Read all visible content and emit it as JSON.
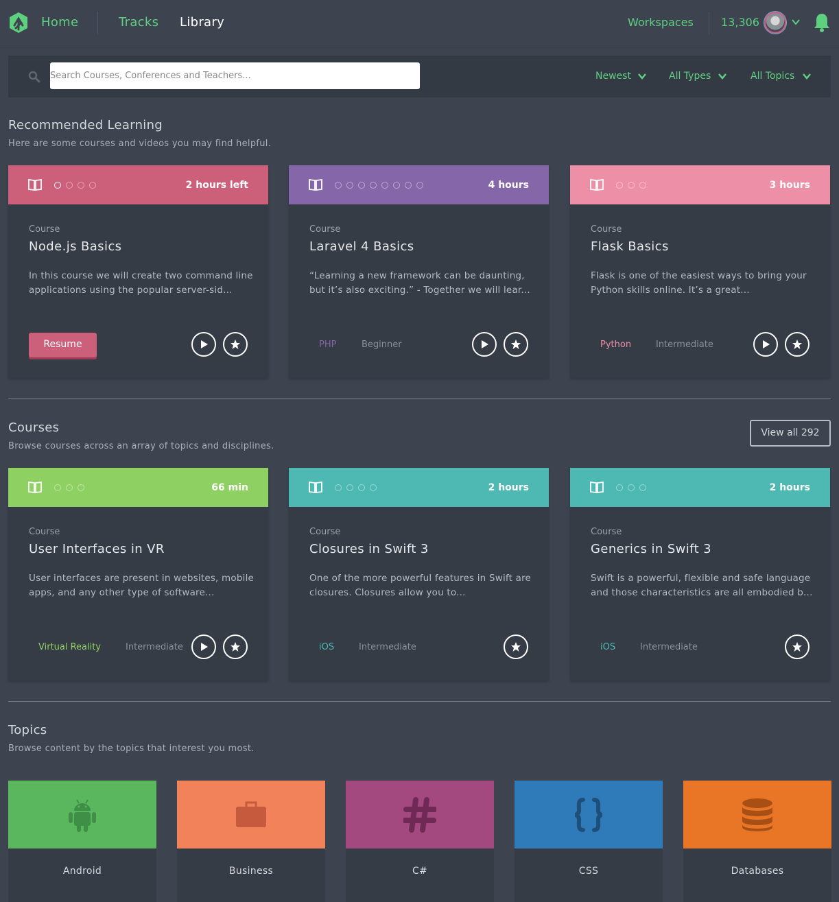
{
  "nav": {
    "home": "Home",
    "tracks": "Tracks",
    "library": "Library",
    "workspaces": "Workspaces",
    "points": "13,306"
  },
  "search": {
    "placeholder": "Search Courses, Conferences and Teachers...",
    "filters": [
      "Newest",
      "All Types",
      "All Topics"
    ]
  },
  "colors": {
    "accent": "#5fcf80",
    "nodejs": "#cc5f79",
    "laravel": "#8566a8",
    "flask": "#ee8fa8",
    "vr": "#8fd063",
    "swift": "#4eb8b3",
    "android": "#5ab75e",
    "business": "#f1825a",
    "csharp": "#a4497f",
    "css": "#2f7bb9",
    "databases": "#e97627"
  },
  "recommended": {
    "title": "Recommended Learning",
    "subtitle": "Here are some courses and videos you may find helpful.",
    "cards": [
      {
        "type": "Course",
        "title": "Node.js Basics",
        "duration": "2 hours left",
        "description": "In this course we will create two command line applications using the popular server-sid...",
        "action": "Resume",
        "tag": "",
        "level": ""
      },
      {
        "type": "Course",
        "title": "Laravel 4 Basics",
        "duration": "4 hours",
        "description": "“Learning a new framework can be daunting, but it’s also exciting.” - Together we will lear...",
        "tag": "PHP",
        "level": "Beginner"
      },
      {
        "type": "Course",
        "title": "Flask Basics",
        "duration": "3 hours",
        "description": "Flask is one of the easiest ways to bring your Python skills online. It’s a great...",
        "tag": "Python",
        "level": "Intermediate"
      }
    ]
  },
  "courses": {
    "title": "Courses",
    "subtitle": "Browse courses across an array of topics and disciplines.",
    "view_all": "View all 292",
    "cards": [
      {
        "type": "Course",
        "title": "User Interfaces in VR",
        "duration": "66 min",
        "description": "User interfaces are present in websites, mobile apps, and any other type of software...",
        "tag": "Virtual Reality",
        "level": "Intermediate"
      },
      {
        "type": "Course",
        "title": "Closures in Swift 3",
        "duration": "2 hours",
        "description": "One of the more powerful features in Swift are closures. Closures allow you to...",
        "tag": "iOS",
        "level": "Intermediate"
      },
      {
        "type": "Course",
        "title": "Generics in Swift 3",
        "duration": "2 hours",
        "description": "Swift is a powerful, flexible and safe language and those characteristics are all embodied b...",
        "tag": "iOS",
        "level": "Intermediate"
      }
    ]
  },
  "topics": {
    "title": "Topics",
    "subtitle": "Browse content by the topics that interest you most.",
    "items": [
      {
        "label": "Android",
        "icon": "android-icon"
      },
      {
        "label": "Business",
        "icon": "briefcase-icon"
      },
      {
        "label": "C#",
        "icon": "hash-icon"
      },
      {
        "label": "CSS",
        "icon": "curly-braces-icon"
      },
      {
        "label": "Databases",
        "icon": "database-icon"
      }
    ]
  }
}
